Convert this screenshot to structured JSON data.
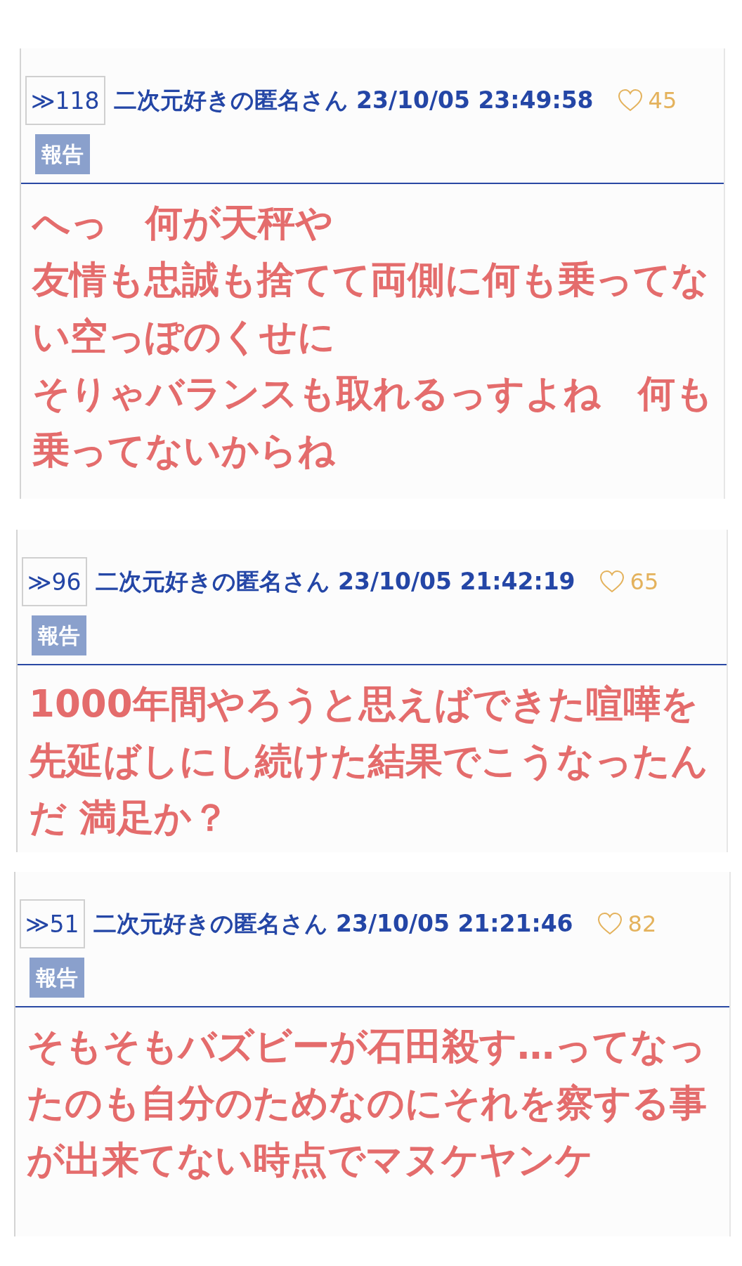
{
  "posts": [
    {
      "number": "≫118",
      "author": "二次元好きの匿名さん",
      "timestamp": "23/10/05 23:49:58",
      "likes": "45",
      "report": "報告",
      "body": [
        "へっ　何が天秤や",
        "友情も忠誠も捨てて両側に何も乗ってない空っぽのくせに",
        "そりゃバランスも取れるっすよね　何も乗ってないからね"
      ]
    },
    {
      "number": "≫96",
      "author": "二次元好きの匿名さん",
      "timestamp": "23/10/05 21:42:19",
      "likes": "65",
      "report": "報告",
      "body": [
        "1000年間やろうと思えばできた喧嘩を先延ばしにし続けた結果でこうなったんだ 満足か？"
      ]
    },
    {
      "number": "≫51",
      "author": "二次元好きの匿名さん",
      "timestamp": "23/10/05 21:21:46",
      "likes": "82",
      "report": "報告",
      "body": [
        "そもそもバズビーが石田殺す…ってなったのも自分のためなのにそれを察する事が出来てない時点でマヌケヤンケ"
      ]
    }
  ]
}
